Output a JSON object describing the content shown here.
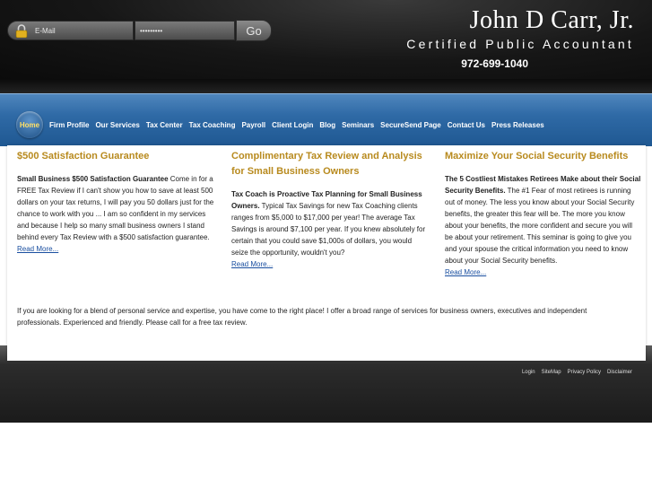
{
  "login": {
    "email_placeholder": "E-Mail",
    "password_mask": "•••••••••",
    "go_label": "Go"
  },
  "brand": {
    "name": "John D Carr, Jr.",
    "title": "Certified Public Accountant",
    "phone": "972-699-1040"
  },
  "nav": {
    "items": [
      "Home",
      "Firm Profile",
      "Our Services",
      "Tax Center",
      "Tax Coaching",
      "Payroll",
      "Client Login",
      "Blog",
      "Seminars",
      "SecureSend Page",
      "Contact Us",
      "Press Releases"
    ]
  },
  "columns": [
    {
      "heading": "$500 Satisfaction Guarantee",
      "lead": "Small Business $500 Satisfaction Guarantee",
      "body": " Come in for a FREE Tax Review if I can't show you how to save at least 500 dollars on your tax returns, I will pay you 50 dollars just for the chance to work with you ... I am so confident in my services and because I help so many small business owners I stand behind every Tax Review with a $500 satisfaction guarantee.",
      "link": "Read More..."
    },
    {
      "heading": "Complimentary Tax Review and Analysis for Small Business Owners",
      "lead": "Tax Coach is Proactive Tax Planning for Small Business Owners.",
      "body": " Typical Tax Savings for new Tax Coaching clients ranges from $5,000 to $17,000 per year! The average Tax Savings is around $7,100 per year. If you knew absolutely for certain that you could save $1,000s of dollars, you would seize the opportunity, wouldn't you?",
      "link": "Read More..."
    },
    {
      "heading": "Maximize Your Social Security Benefits",
      "lead": "The 5 Costliest Mistakes Retirees Make about their Social Security Benefits.",
      "body": " The #1 Fear of most retirees is running out of money. The less you know about your Social Security benefits, the greater this fear will be. The more you know about your benefits, the more confident and secure you will be about your retirement. This seminar is going to give you and your spouse the critical information you need to know about your Social Security benefits.",
      "link": "Read More..."
    }
  ],
  "intro": "If you are looking for a blend of personal service and expertise, you have come to the right place! I offer a broad range of services for business owners, executives and independent professionals. Experienced and friendly. Please call for a free tax review.",
  "footer": {
    "links": [
      "Login",
      "SiteMap",
      "Privacy Policy",
      "Disclaimer"
    ]
  }
}
